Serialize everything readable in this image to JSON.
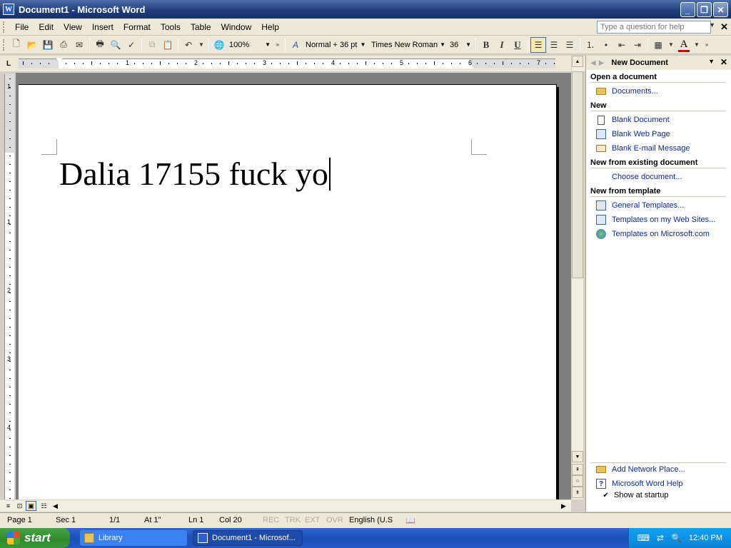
{
  "window": {
    "title": "Document1 - Microsoft Word",
    "app_icon": "W",
    "controls": {
      "minimize": "_",
      "maximize": "❐",
      "close": "✕"
    }
  },
  "menu": {
    "items": [
      "File",
      "Edit",
      "View",
      "Insert",
      "Format",
      "Tools",
      "Table",
      "Window",
      "Help"
    ],
    "help_placeholder": "Type a question for help"
  },
  "toolbar": {
    "zoom": "100%",
    "style": "Normal + 36 pt",
    "font": "Times New Roman",
    "size": "36",
    "bold": "B",
    "italic": "I",
    "underline": "U",
    "font_color_label": "A"
  },
  "ruler": {
    "numbers": [
      "1",
      "2",
      "3",
      "4",
      "5",
      "6",
      "7"
    ],
    "vnumbers": [
      "1",
      "1",
      "2",
      "3",
      "4"
    ]
  },
  "document": {
    "text": "Dalia 17155 fuck yo"
  },
  "task_pane": {
    "title": "New Document",
    "sections": {
      "open": "Open a document",
      "new": "New",
      "existing": "New from existing document",
      "template": "New from template"
    },
    "links": {
      "documents": "Documents...",
      "blank_doc": "Blank Document",
      "blank_web": "Blank Web Page",
      "blank_email": "Blank E-mail Message",
      "choose": "Choose document...",
      "general_templates": "General Templates...",
      "web_sites": "Templates on my Web Sites...",
      "ms_templates": "Templates on Microsoft.com",
      "network_place": "Add Network Place...",
      "word_help": "Microsoft Word Help"
    },
    "show_at_startup": "Show at startup"
  },
  "status": {
    "page": "Page 1",
    "sec": "Sec 1",
    "pages": "1/1",
    "at": "At 1\"",
    "ln": "Ln 1",
    "col": "Col 20",
    "rec": "REC",
    "trk": "TRK",
    "ext": "EXT",
    "ovr": "OVR",
    "language": "English (U.S"
  },
  "taskbar": {
    "start": "start",
    "items": [
      "Library",
      "Document1 - Microsof..."
    ],
    "clock": "12:40 PM"
  }
}
